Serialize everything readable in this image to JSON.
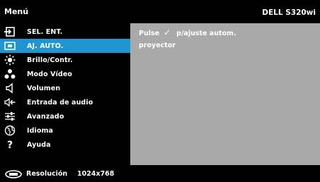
{
  "header": {
    "title": "Menú",
    "model": "DELL S320wi"
  },
  "menu": {
    "items": [
      {
        "label": "SEL. ENT.",
        "icon": "input-select-icon",
        "selected": false
      },
      {
        "label": "AJ. AUTO.",
        "icon": "auto-adjust-icon",
        "selected": true
      },
      {
        "label": "Brillo/Contr.",
        "icon": "brightness-icon",
        "selected": false
      },
      {
        "label": "Modo Vídeo",
        "icon": "video-mode-icon",
        "selected": false
      },
      {
        "label": "Volumen",
        "icon": "speaker-icon",
        "selected": false
      },
      {
        "label": "Entrada de audio",
        "icon": "audio-input-icon",
        "selected": false
      },
      {
        "label": "Avanzado",
        "icon": "advanced-settings-icon",
        "selected": false
      },
      {
        "label": "Idioma",
        "icon": "globe-icon",
        "selected": false
      },
      {
        "label": "Ayuda",
        "icon": "help-icon",
        "selected": false
      }
    ]
  },
  "content": {
    "line1_pre": "Pulse",
    "line1_post": "p/ajuste autom.",
    "line2": "proyector"
  },
  "footer": {
    "label": "Resolución",
    "value": "1024x768"
  },
  "colors": {
    "highlight": "#1f95d2",
    "panel": "#a9a9a9",
    "background": "#000000"
  }
}
